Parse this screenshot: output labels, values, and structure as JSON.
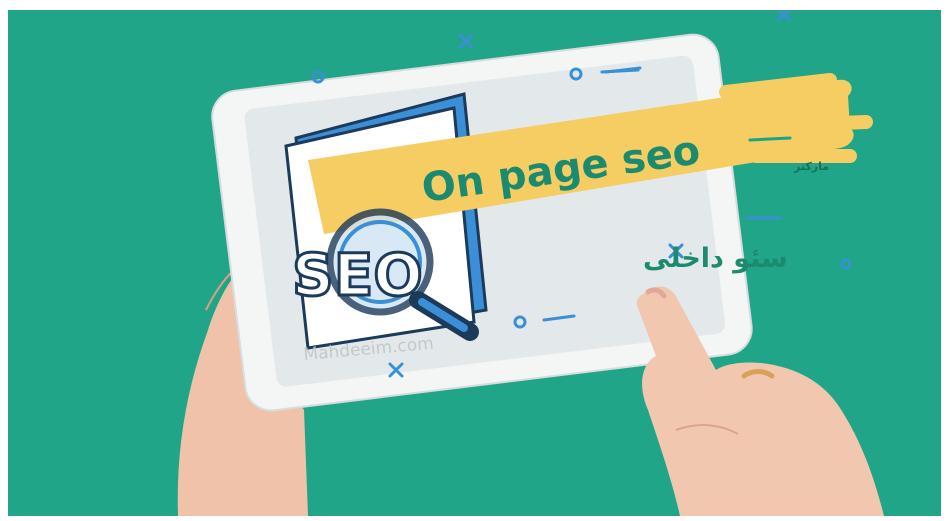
{
  "banner": {
    "headline": "On page seo",
    "brand_mark": "مارکتر"
  },
  "screen": {
    "subtitle": "سئو داخلی",
    "seo_word": "SEO",
    "watermark": "Mahdeeim.com"
  },
  "colors": {
    "background": "#1fa386",
    "banner": "#f6cd62",
    "headline_text": "#1b8a6f",
    "accent_blue": "#3b8fd6",
    "tablet_frame": "#f2f3f3",
    "screen": "#e6ebec",
    "skin": "#f2c7b0"
  },
  "icons": [
    "magnifier-icon",
    "document-icon",
    "cross-mark-icon",
    "circle-mark-icon"
  ]
}
